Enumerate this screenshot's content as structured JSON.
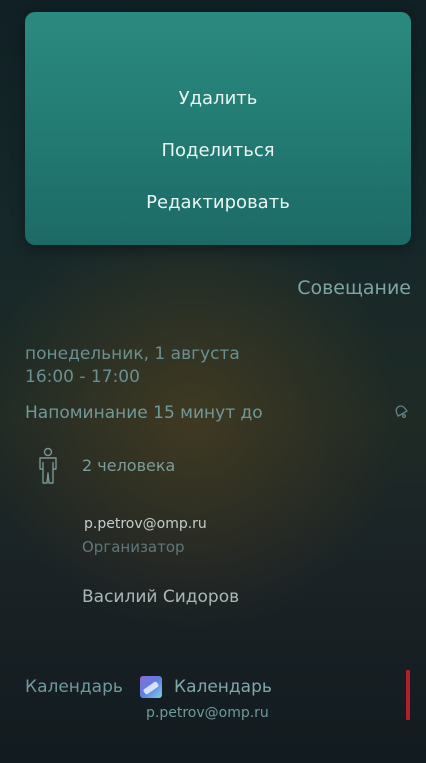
{
  "context_menu": {
    "delete_label": "Удалить",
    "share_label": "Поделиться",
    "edit_label": "Редактировать"
  },
  "event": {
    "title": "Совещание",
    "date": "понедельник, 1 августа",
    "time": "16:00 - 17:00",
    "reminder": "Напоминание 15 минут до",
    "participants_count": "2 человека",
    "organizer_email": "p.petrov@omp.ru",
    "organizer_role": "Организатор",
    "attendee_name": "Василий Сидоров",
    "calendar_label": "Календарь",
    "calendar_name": "Календарь",
    "calendar_account": "p.petrov@omp.ru"
  },
  "icons": {
    "reminder": "bell-icon",
    "participants": "person-icon",
    "calendar": "calendar-app-icon"
  },
  "colors": {
    "menu_background": "#227a72",
    "calendar_color": "#b3202a"
  }
}
